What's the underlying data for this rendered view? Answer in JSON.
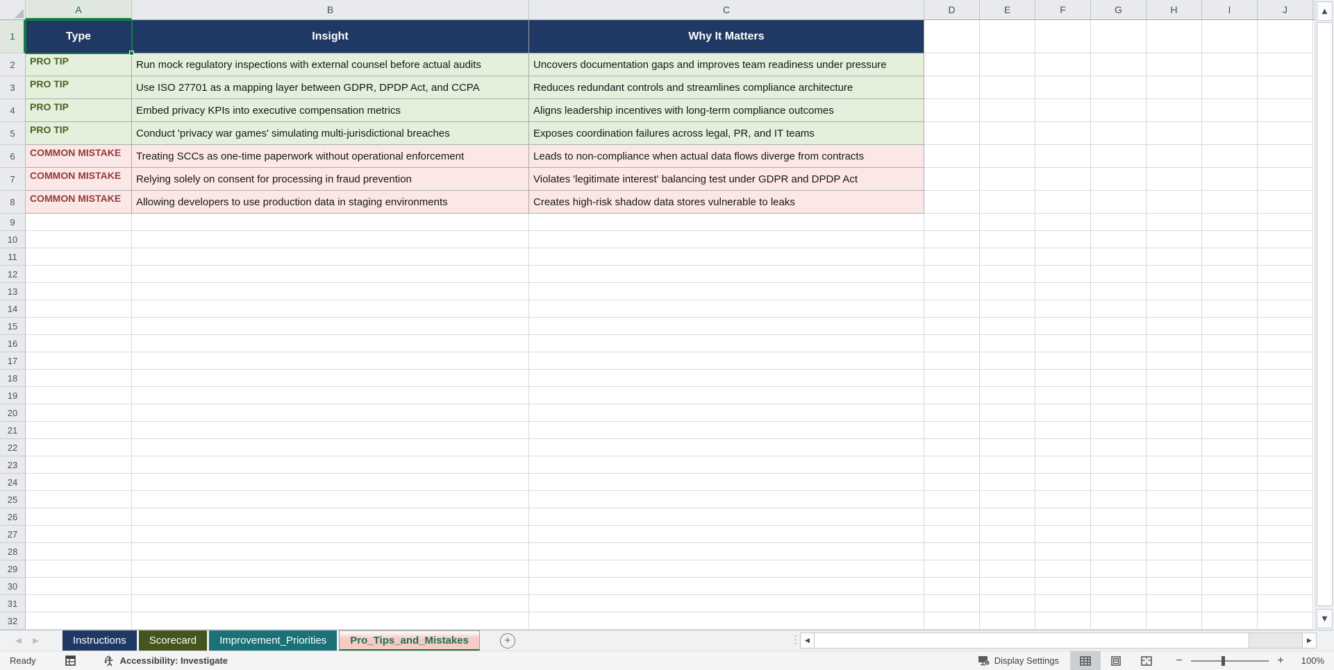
{
  "grid": {
    "columns": [
      "A",
      "B",
      "C",
      "D",
      "E",
      "F",
      "G",
      "H",
      "I",
      "J"
    ],
    "last_row": 32,
    "selected_cell": "A1",
    "selected_col": "A",
    "selected_row": 1
  },
  "table": {
    "headers": [
      "Type",
      "Insight",
      "Why It Matters"
    ],
    "rows": [
      {
        "kind": "protip",
        "type": "PRO TIP",
        "insight": "Run mock regulatory inspections with external counsel before actual audits",
        "why": "Uncovers documentation gaps and improves team readiness under pressure"
      },
      {
        "kind": "protip",
        "type": "PRO TIP",
        "insight": "Use ISO 27701 as a mapping layer between GDPR, DPDP Act, and CCPA",
        "why": "Reduces redundant controls and streamlines compliance architecture"
      },
      {
        "kind": "protip",
        "type": "PRO TIP",
        "insight": "Embed privacy KPIs into executive compensation metrics",
        "why": "Aligns leadership incentives with long-term compliance outcomes"
      },
      {
        "kind": "protip",
        "type": "PRO TIP",
        "insight": "Conduct 'privacy war games' simulating multi-jurisdictional breaches",
        "why": "Exposes coordination failures across legal, PR, and IT teams"
      },
      {
        "kind": "mistake",
        "type": "COMMON MISTAKE",
        "insight": "Treating SCCs as one-time paperwork without operational enforcement",
        "why": "Leads to non-compliance when actual data flows diverge from contracts"
      },
      {
        "kind": "mistake",
        "type": "COMMON MISTAKE",
        "insight": "Relying solely on consent for processing in fraud prevention",
        "why": "Violates 'legitimate interest' balancing test under GDPR and DPDP Act"
      },
      {
        "kind": "mistake",
        "type": "COMMON MISTAKE",
        "insight": "Allowing developers to use production data in staging environments",
        "why": "Creates high-risk shadow data stores vulnerable to leaks"
      }
    ]
  },
  "tabs": {
    "items": [
      {
        "label": "Instructions",
        "fill": "#1F3864",
        "text": "#FFFFFF",
        "active": false
      },
      {
        "label": "Scorecard",
        "fill": "#44551E",
        "text": "#FFFFFF",
        "active": false
      },
      {
        "label": "Improvement_Priorities",
        "fill": "#1B7178",
        "text": "#FFFFFF",
        "active": false
      },
      {
        "label": "Pro_Tips_and_Mistakes",
        "fill": "#F5CBC7",
        "text": "#1E7145",
        "active": true
      }
    ]
  },
  "status": {
    "ready": "Ready",
    "accessibility": "Accessibility: Investigate",
    "display_settings": "Display Settings",
    "zoom": "100%"
  },
  "icons": {
    "tab_nav_left": "◀",
    "tab_nav_right": "▶",
    "scroll_up": "▲",
    "scroll_down": "▼",
    "scroll_left": "◀",
    "scroll_right": "▶",
    "add_sheet": "+",
    "tab_drag_dots": "⋮",
    "zoom_out": "−",
    "zoom_in": "+"
  },
  "colors": {
    "navy": "#1F3864",
    "green_fill": "#E4F0DC",
    "green_text": "#44631E",
    "pink_fill": "#FBE8E6",
    "maroon_text": "#913A38",
    "excel_green": "#107C41"
  }
}
